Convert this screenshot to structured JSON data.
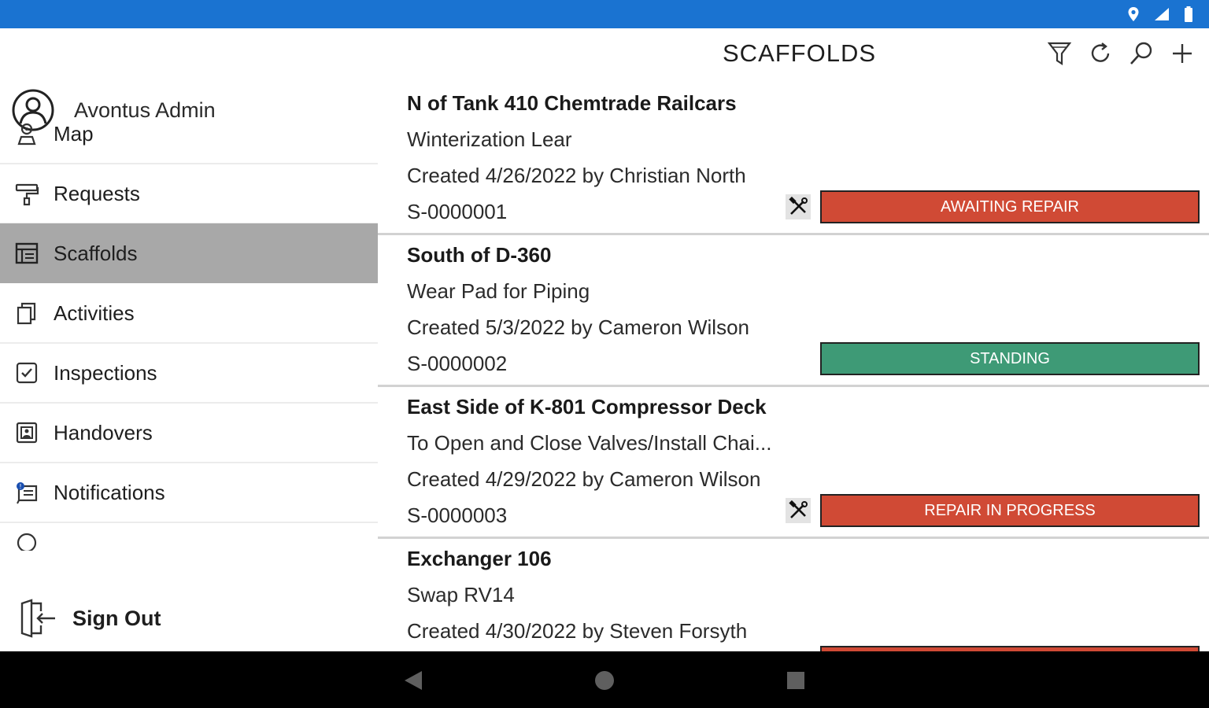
{
  "page": {
    "title": "SCAFFOLDS"
  },
  "user": {
    "name": "Avontus Admin"
  },
  "menu": [
    {
      "label": "Map",
      "icon": "map-person-icon"
    },
    {
      "label": "Requests",
      "icon": "paint-roller-icon"
    },
    {
      "label": "Scaffolds",
      "icon": "table-layout-icon",
      "active": true
    },
    {
      "label": "Activities",
      "icon": "copy-pages-icon"
    },
    {
      "label": "Inspections",
      "icon": "checkbox-icon"
    },
    {
      "label": "Handovers",
      "icon": "handover-icon"
    },
    {
      "label": "Notifications",
      "icon": "notification-icon"
    }
  ],
  "signout": {
    "label": "Sign Out"
  },
  "toolbar": [
    "filter-icon",
    "refresh-icon",
    "search-icon",
    "add-icon"
  ],
  "colors": {
    "status_bar": "#1a73d1",
    "red_status": "#d04a35",
    "green_status": "#3e9a76",
    "active_menu": "#a8a8a8"
  },
  "scaffolds": [
    {
      "location": "N of Tank 410  Chemtrade Railcars",
      "description": "Winterization Lear",
      "created": "Created 4/26/2022 by Christian North",
      "number": "S-0000001",
      "status": "AWAITING REPAIR",
      "status_color": "red",
      "has_tool_icon": true
    },
    {
      "location": "South of D-360",
      "description": "Wear Pad for Piping",
      "created": "Created 5/3/2022 by Cameron Wilson",
      "number": "S-0000002",
      "status": "STANDING",
      "status_color": "green",
      "has_tool_icon": false
    },
    {
      "location": "East Side of K-801 Compressor Deck",
      "description": "To Open and Close Valves/Install Chai...",
      "created": "Created 4/29/2022 by Cameron Wilson",
      "number": "S-0000003",
      "status": "REPAIR IN PROGRESS",
      "status_color": "red",
      "has_tool_icon": true
    },
    {
      "location": "Exchanger 106",
      "description": "Swap RV14",
      "created": "Created 4/30/2022 by Steven Forsyth"
    }
  ]
}
